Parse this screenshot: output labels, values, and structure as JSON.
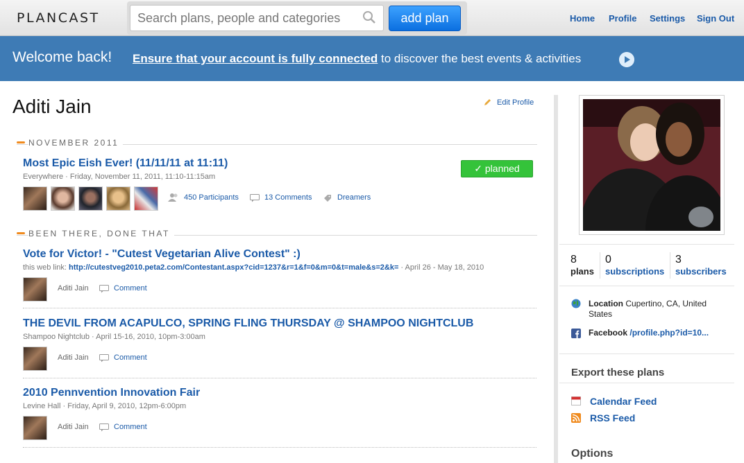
{
  "header": {
    "logo": "PLANCAST",
    "search_placeholder": "Search plans, people and categories",
    "add_plan": "add plan",
    "nav": [
      "Home",
      "Profile",
      "Settings",
      "Sign Out"
    ]
  },
  "welcome": {
    "title": "Welcome back!",
    "link": "Ensure that your account is fully connected",
    "rest": "to discover the best events & activities"
  },
  "profile": {
    "name": "Aditi Jain",
    "edit": "Edit Profile"
  },
  "sections": {
    "upcoming": "NOVEMBER 2011",
    "past": "BEEN THERE, DONE THAT"
  },
  "upcoming_plan": {
    "title": "Most Epic Eish Ever! (11/11/11 at 11:11)",
    "meta": "Everywhere · Friday, November 11, 2011, 11:10-11:15am",
    "status": "planned",
    "participants": "450 Participants",
    "comments": "13 Comments",
    "tag": "Dreamers"
  },
  "past_plans": [
    {
      "title": "Vote for Victor! - \"Cutest Vegetarian Alive Contest\" :)",
      "meta_prefix": "this web link: ",
      "meta_link": "http://cutestveg2010.peta2.com/Contestant.aspx?cid=1237&r=1&f=0&m=0&t=male&s=2&k=",
      "meta_suffix": " · April 26 - May 18, 2010",
      "user": "Aditi Jain",
      "comment": "Comment"
    },
    {
      "title": "THE DEVIL FROM ACAPULCO, SPRING FLING THURSDAY @ SHAMPOO NIGHTCLUB",
      "meta": "Shampoo Nightclub · April 15-16, 2010, 10pm-3:00am",
      "user": "Aditi Jain",
      "comment": "Comment"
    },
    {
      "title": "2010 Pennvention Innovation Fair",
      "meta": "Levine Hall · Friday, April 9, 2010, 12pm-6:00pm",
      "user": "Aditi Jain",
      "comment": "Comment"
    }
  ],
  "stats": [
    {
      "value": "8",
      "label": "plans"
    },
    {
      "value": "0",
      "label": "subscriptions"
    },
    {
      "value": "3",
      "label": "subscribers"
    }
  ],
  "info": {
    "location_label": "Location",
    "location_value": "Cupertino, CA, United States",
    "facebook_label": "Facebook",
    "facebook_value": "/profile.php?id=10..."
  },
  "export": {
    "title": "Export these plans",
    "calendar": "Calendar Feed",
    "rss": "RSS Feed"
  },
  "options_title": "Options",
  "colors": {
    "accent": "#1a5aa8",
    "banner": "#3e7bb5",
    "planned": "#34c33a",
    "section_dash": "#f08a1d"
  }
}
